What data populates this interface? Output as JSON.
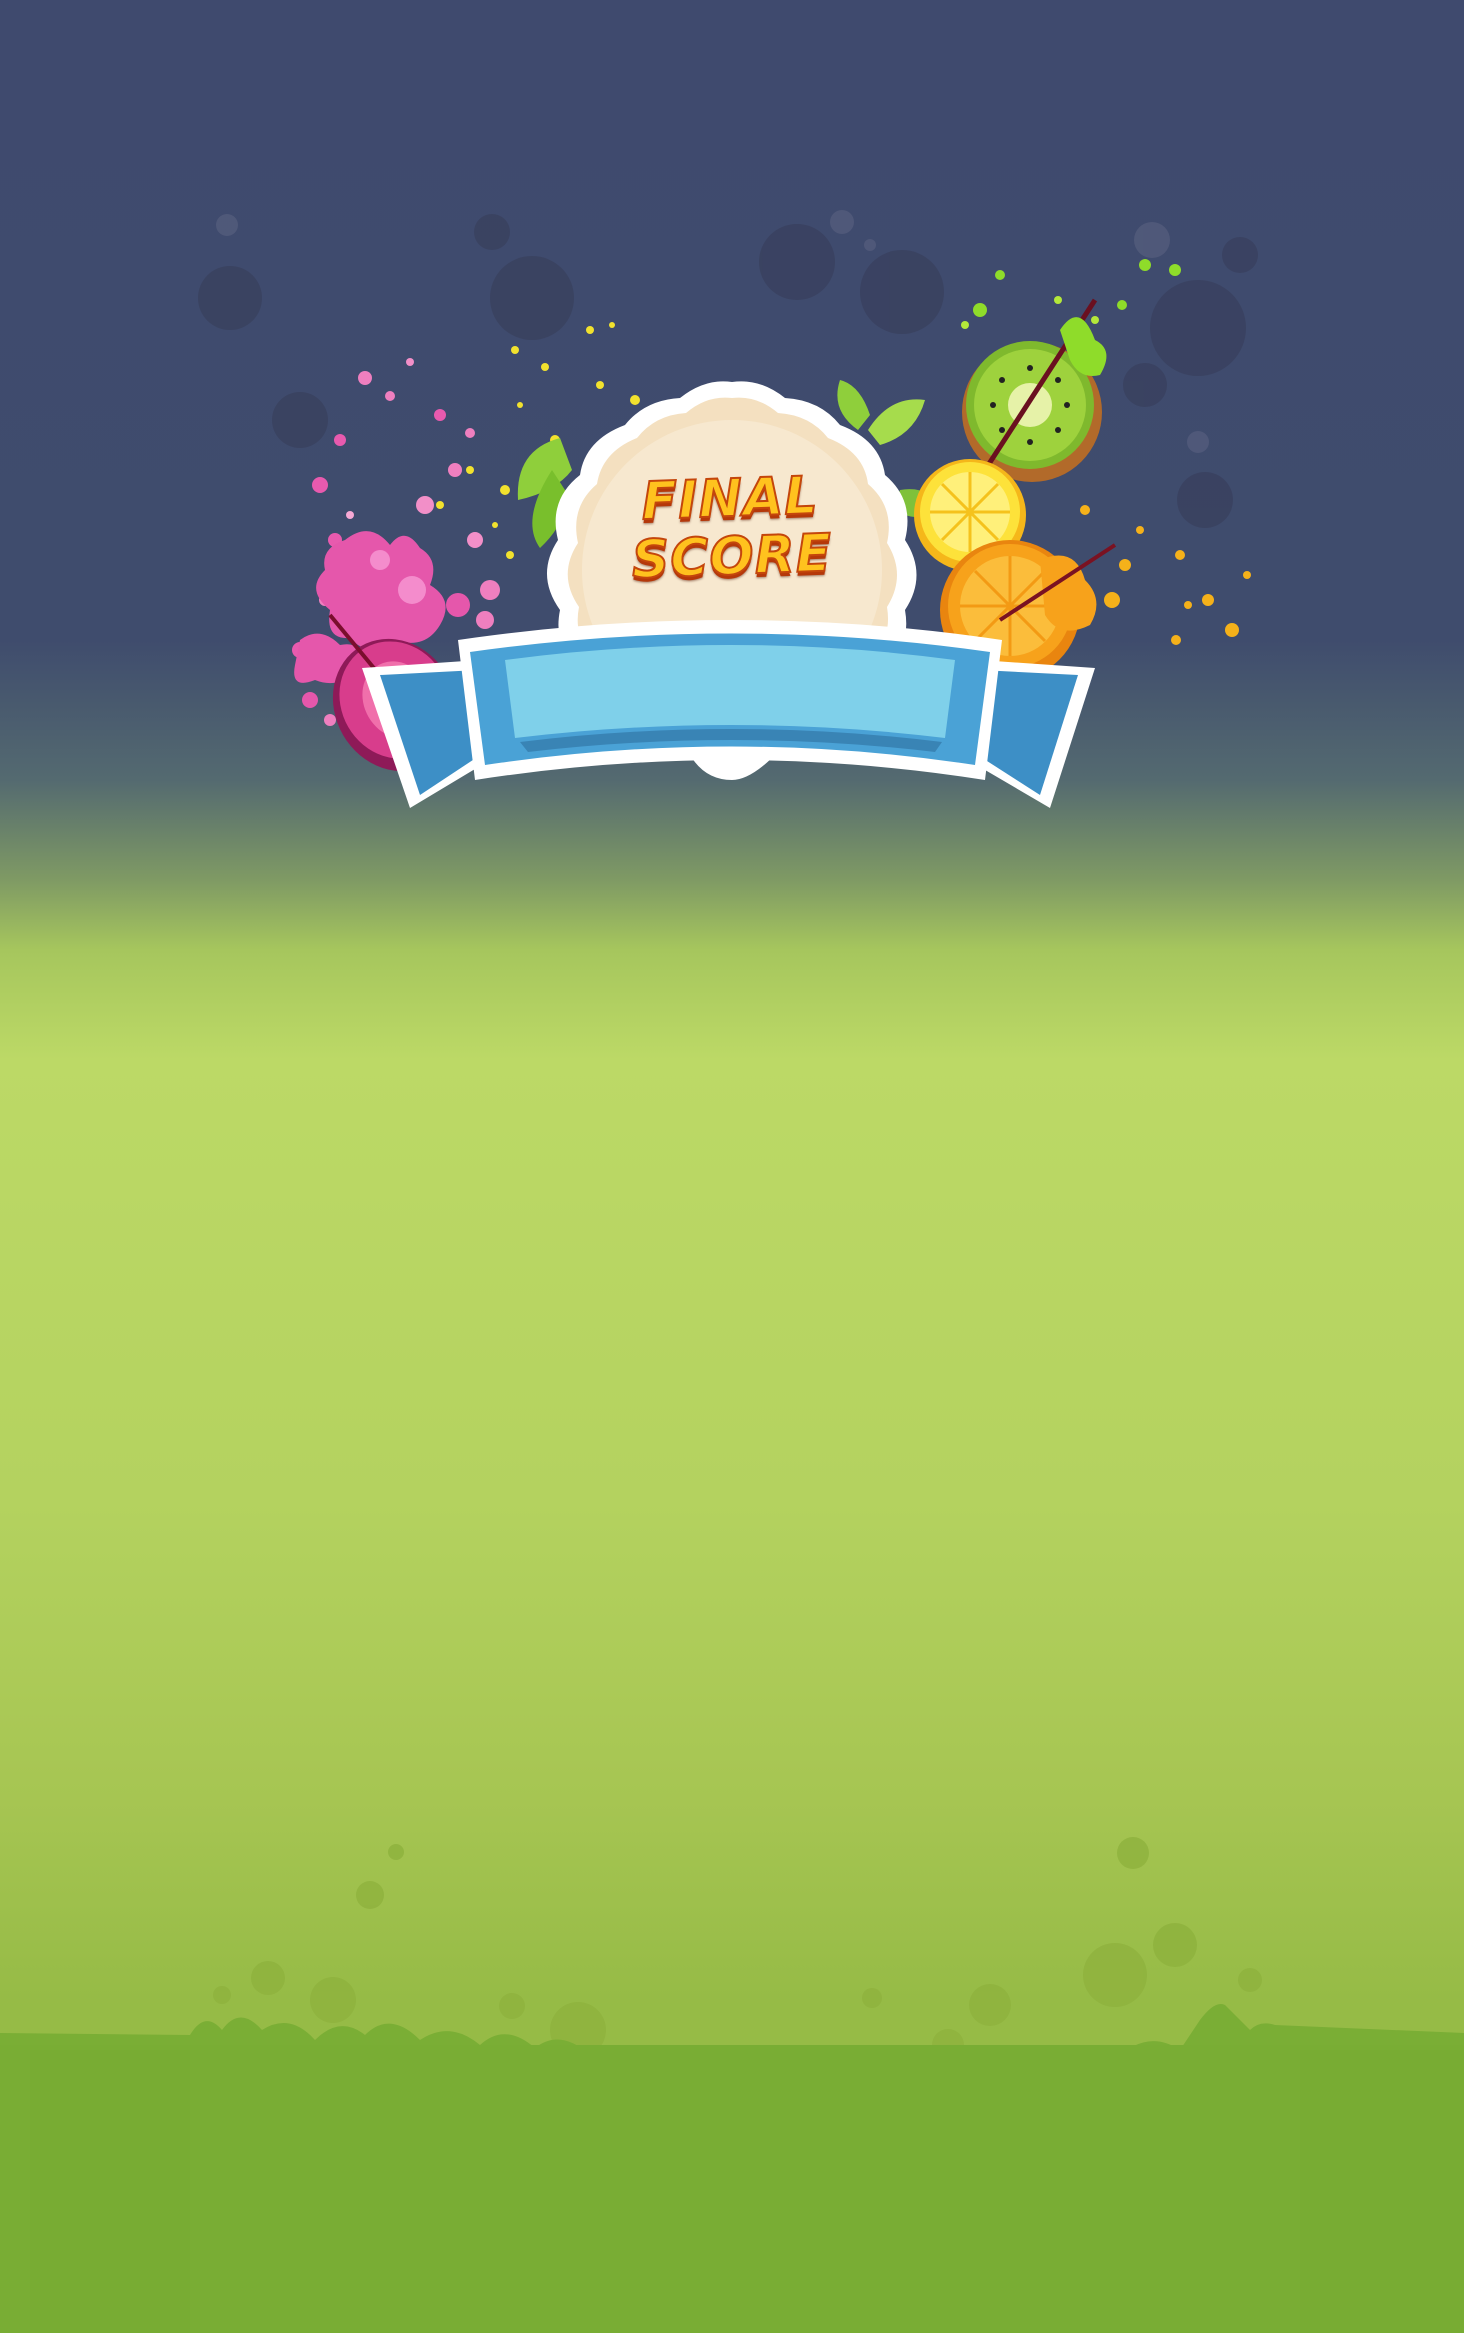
{
  "screen": "game-over",
  "badge": {
    "title": "FINAL\nSCORE",
    "score_value": ""
  },
  "colors": {
    "sky": "#3f4a6e",
    "meadow": "#bcd966",
    "grass": "#7aae35",
    "badge_cream": "#f4e0c0",
    "ribbon_light": "#7fd0ea",
    "ribbon_dark": "#3d8fc6",
    "title_fill": "#ffc21e",
    "title_stroke": "#c4460c"
  },
  "decorations": [
    "dragonfruit-icon",
    "kiwi-icon",
    "lemon-icon",
    "orange-icon",
    "leaf-icon",
    "juice-splash-icon",
    "bubble-icon",
    "grass-icon"
  ]
}
